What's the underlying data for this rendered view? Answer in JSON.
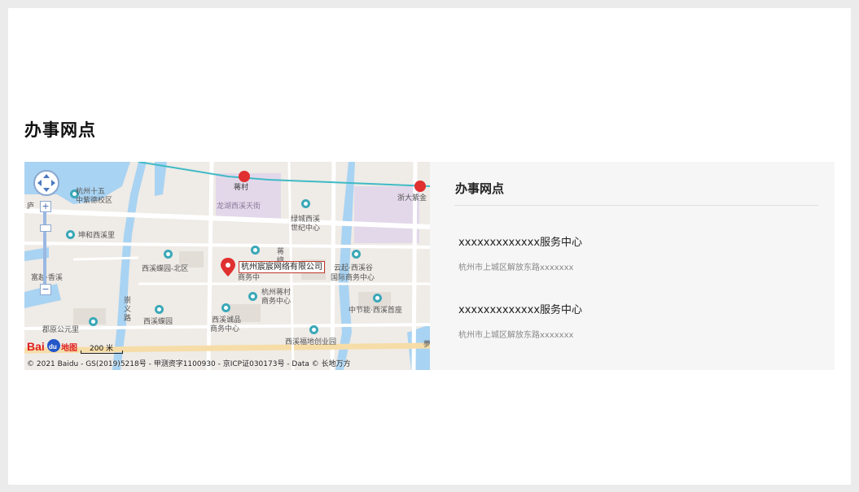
{
  "section": {
    "title": "办事网点"
  },
  "map": {
    "company_label": "杭州宸宸网络有限公司",
    "scale_label": "200 米",
    "copyright": "© 2021 Baidu - GS(2019)5218号 - 甲测资字1100930 - 京ICP证030173号 - Data © 长地万方",
    "logo_text": "Bai地图",
    "zoom_in": "+",
    "zoom_out": "−",
    "labels": {
      "jiangcun": "蒋村",
      "hz15_1": "杭州十五",
      "hz15_2": "中紫德校区",
      "xu": "庐",
      "longhu": "龙湖西溪天街",
      "lvcheng1": "绿城西溪",
      "lvcheng2": "世纪中心",
      "zheda": "浙大紫金",
      "kunhe": "坤和西溪里",
      "xixidie_n": "西溪蝶园-北区",
      "jiangcun2": "蒋",
      "jiangcun3": "嶼",
      "jiangcun_biz": "商务中",
      "yunqi1": "云起·西溪谷",
      "yunqi2": "国际商务中心",
      "fuyang": "富越·香溪",
      "hzjc1": "杭州蒋村",
      "hzjc2": "商务中心",
      "chongyi1": "崇",
      "chongyi2": "义",
      "chongyi3": "路",
      "zhongjie": "中节能·西溪首座",
      "junyuan": "郡原公元里",
      "xixidie": "西溪蝶园",
      "chengpin1": "西溪诚品",
      "chengpin2": "商务中心",
      "xixifudi": "西溪福地创业园",
      "right_edge": "夢"
    }
  },
  "panel": {
    "title": "办事网点",
    "offices": [
      {
        "name": "xxxxxxxxxxxxx服务中心",
        "address": "杭州市上城区解放东路xxxxxxx"
      },
      {
        "name": "xxxxxxxxxxxxx服务中心",
        "address": "杭州市上城区解放东路xxxxxxx"
      }
    ]
  },
  "colors": {
    "page_bg": "#ebebeb",
    "card_bg": "#ffffff",
    "panel_bg": "#f6f6f6",
    "water": "#a9d3f2",
    "road": "#ffffff",
    "metro_line": "#3fbac6",
    "marker": "#e03030",
    "poi": "#3aa8b8"
  }
}
